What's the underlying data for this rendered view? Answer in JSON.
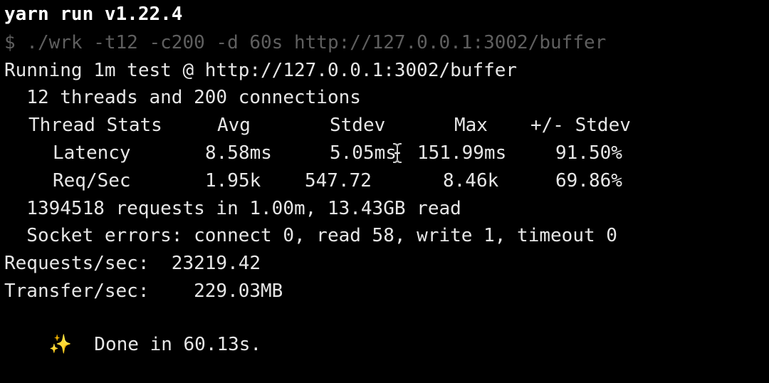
{
  "terminal": {
    "header": "yarn run v1.22.4",
    "command": "$ ./wrk -t12 -c200 -d 60s http://127.0.0.1:3002/buffer",
    "running": "Running 1m test @ http://127.0.0.1:3002/buffer",
    "threads_conns": "  12 threads and 200 connections",
    "stats_table": {
      "label": "Thread Stats",
      "headers": [
        "Avg",
        "Stdev",
        "Max",
        "+/- Stdev"
      ],
      "rows": [
        {
          "name": "Latency",
          "avg": "8.58ms",
          "stdev": "5.05ms",
          "max": "151.99ms",
          "pm_stdev": "91.50%"
        },
        {
          "name": "Req/Sec",
          "avg": "1.95k",
          "stdev": "547.72",
          "max": "8.46k",
          "pm_stdev": "69.86%"
        }
      ]
    },
    "requests_summary": "  1394518 requests in 1.00m, 13.43GB read",
    "socket_errors": "  Socket errors: connect 0, read 58, write 1, timeout 0",
    "requests_sec": "Requests/sec:  23219.42",
    "transfer_sec": "Transfer/sec:    229.03MB",
    "done_icon": "sparkles-icon",
    "done_text": "  Done in 60.13s."
  },
  "colors": {
    "background": "#000000",
    "foreground": "#e6e6e6",
    "dim": "#5f5f5f",
    "sparkle": "#f5d142"
  }
}
